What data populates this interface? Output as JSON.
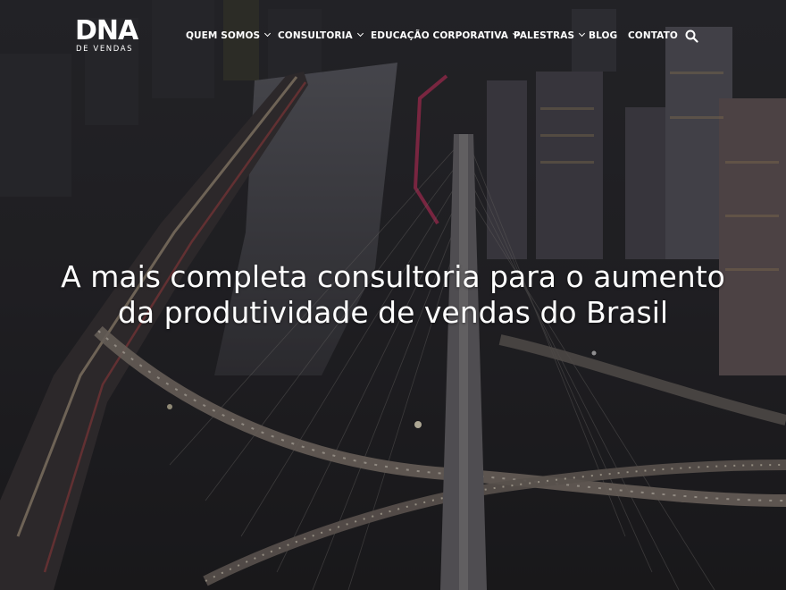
{
  "brand": {
    "logo_main": "DNA",
    "logo_sub": "DE VENDAS"
  },
  "nav": {
    "items": [
      {
        "label": "QUEM SOMOS",
        "has_dropdown": true
      },
      {
        "label": "CONSULTORIA",
        "has_dropdown": true
      },
      {
        "label": "EDUCAÇÃO CORPORATIVA",
        "has_dropdown": true
      },
      {
        "label": "PALESTRAS",
        "has_dropdown": true
      },
      {
        "label": "BLOG",
        "has_dropdown": false
      },
      {
        "label": "CONTATO",
        "has_dropdown": false
      }
    ],
    "search_icon": "search-icon"
  },
  "hero": {
    "headline_line1": "A mais completa consultoria para o aumento",
    "headline_line2": "da produtividade de vendas do Brasil",
    "background": "night city aerial with cable-stayed bridge"
  },
  "colors": {
    "text": "#ffffff",
    "overlay": "#1a1a1c"
  }
}
